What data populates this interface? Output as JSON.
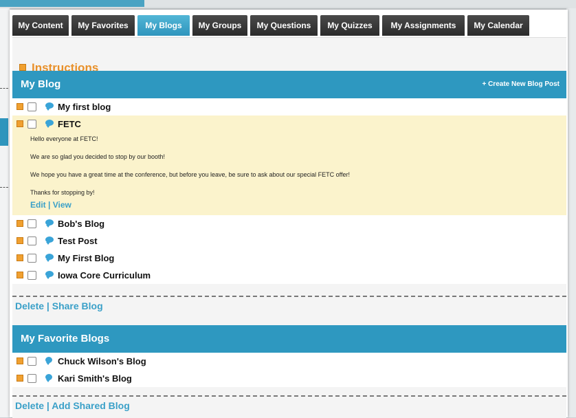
{
  "tabs": [
    {
      "label": "My Content",
      "active": false
    },
    {
      "label": "My Favorites",
      "active": false
    },
    {
      "label": "My Blogs",
      "active": true
    },
    {
      "label": "My Groups",
      "active": false
    },
    {
      "label": "My Questions",
      "active": false
    },
    {
      "label": "My Quizzes",
      "active": false
    },
    {
      "label": "My Assignments",
      "active": false
    },
    {
      "label": "My Calendar",
      "active": false
    }
  ],
  "instructions": {
    "label": "Instructions"
  },
  "my_blog": {
    "header": "My Blog",
    "create_link": "+ Create New Blog Post",
    "posts": [
      {
        "title": "My first blog"
      },
      {
        "title": "FETC"
      },
      {
        "title": "Bob's Blog"
      },
      {
        "title": "Test Post"
      },
      {
        "title": "My First Blog"
      },
      {
        "title": "Iowa Core Curriculum"
      }
    ],
    "expanded_body": [
      "Hello everyone at FETC!",
      "We are so glad you decided to stop by our booth!",
      "We hope you have a great time at the conference, but before you leave, be sure to ask about our special FETC offer!",
      "Thanks for stopping by!"
    ],
    "edit_label": "Edit",
    "view_label": "View",
    "delete_label": "Delete",
    "share_label": "Share Blog"
  },
  "favorite_blogs": {
    "header": "My Favorite Blogs",
    "items": [
      {
        "title": "Chuck Wilson's Blog"
      },
      {
        "title": "Kari Smith's Blog"
      }
    ],
    "delete_label": "Delete",
    "add_label": "Add Shared Blog"
  },
  "separator": "|",
  "colors": {
    "accent_blue": "#2e98c0",
    "tab_dark": "#333333",
    "instructions_orange": "#e8902a",
    "expanded_bg": "#fbf3cc",
    "link_blue": "#3aa0c8"
  },
  "icons": [
    "expand-square-icon",
    "checkbox-icon",
    "blog-bubble-icon"
  ]
}
